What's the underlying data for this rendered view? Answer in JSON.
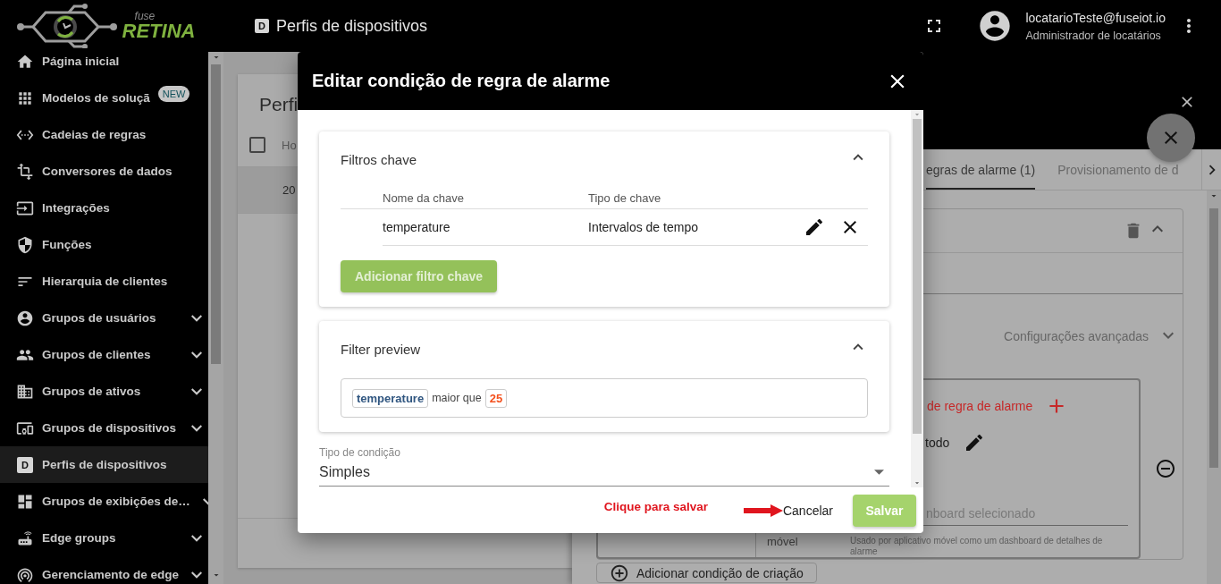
{
  "header": {
    "logo": {
      "small": "fuse",
      "name": "RETINA"
    },
    "page_icon": "D",
    "title": "Perfis de dispositivos",
    "user": {
      "email": "locatarioTeste@fuseiot.io",
      "role": "Administrador de locatários"
    }
  },
  "sidebar": {
    "items": [
      {
        "label": "Página inicial",
        "selected": false,
        "expandable": false
      },
      {
        "label": "Modelos de soluçã",
        "selected": false,
        "expandable": false,
        "badge": "NEW"
      },
      {
        "label": "Cadeias de regras",
        "selected": false,
        "expandable": false
      },
      {
        "label": "Conversores de dados",
        "selected": false,
        "expandable": false
      },
      {
        "label": "Integrações",
        "selected": false,
        "expandable": false
      },
      {
        "label": "Funções",
        "selected": false,
        "expandable": false
      },
      {
        "label": "Hierarquia de clientes",
        "selected": false,
        "expandable": false
      },
      {
        "label": "Grupos de usuários",
        "selected": false,
        "expandable": true
      },
      {
        "label": "Grupos de clientes",
        "selected": false,
        "expandable": true
      },
      {
        "label": "Grupos de ativos",
        "selected": false,
        "expandable": true
      },
      {
        "label": "Grupos de dispositivos",
        "selected": false,
        "expandable": true
      },
      {
        "label": "Perfis de dispositivos",
        "icon_text": "D",
        "selected": true,
        "expandable": false
      },
      {
        "label": "Grupos de exibições de…",
        "selected": false,
        "expandable": true
      },
      {
        "label": "Edge groups",
        "selected": false,
        "expandable": true
      },
      {
        "label": "Gerenciamento de edge",
        "selected": false,
        "expandable": true
      }
    ]
  },
  "list_card": {
    "title": "Perfi",
    "select_all_checked": false,
    "column_1": "Ho",
    "row_cell": "20"
  },
  "detail_panel": {
    "tabs": [
      {
        "label": "egras de alarme (1)",
        "selected": true
      },
      {
        "label": "Provisionamento de d",
        "selected": false
      }
    ],
    "rule_expanded": true,
    "advanced_settings": {
      "label": "Configurações avançadas",
      "expanded": false
    },
    "condition_box": {
      "title": "de regra de alarme",
      "schedule": "todo",
      "side_label": "móvel",
      "dashboard_placeholder": "nboard selecionado",
      "dashboard_hint": "Usado por aplicativo móvel como um dashboard de detalhes de alarme"
    },
    "add_condition": "Adicionar condição de criação"
  },
  "dialog": {
    "title": "Editar condição de regra de alarme",
    "key_filters": {
      "title": "Filtros chave",
      "expanded": true,
      "columns": [
        "Nome da chave",
        "Tipo de chave"
      ],
      "rows": [
        {
          "key_name": "temperature",
          "key_type": "Intervalos de tempo"
        }
      ],
      "add_button": "Adicionar filtro chave"
    },
    "filter_preview": {
      "title": "Filter preview",
      "expanded": true,
      "key": "temperature",
      "operation": "maior que",
      "value": "25"
    },
    "condition_type": {
      "label": "Tipo de condição",
      "value": "Simples"
    },
    "annotation": "Clique para salvar",
    "buttons": {
      "cancel": "Cancelar",
      "save": "Salvar"
    }
  }
}
